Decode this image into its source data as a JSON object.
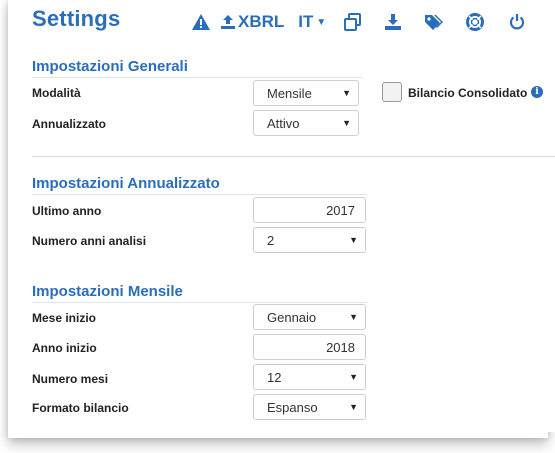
{
  "header": {
    "title": "Settings",
    "icons": [
      "warning-icon",
      "upload-icon",
      "copy-icon",
      "download-icon",
      "tags-icon",
      "lifebuoy-icon",
      "power-icon"
    ],
    "xbrl_label": "XBRL",
    "language": "IT"
  },
  "sections": {
    "generali": {
      "title": "Impostazioni Generali",
      "modalita_label": "Modalità",
      "modalita_value": "Mensile",
      "annualizzato_label": "Annualizzato",
      "annualizzato_value": "Attivo",
      "consolidato_label": "Bilancio Consolidato",
      "consolidato_checked": false
    },
    "annualizzato": {
      "title": "Impostazioni Annualizzato",
      "ultimo_anno_label": "Ultimo anno",
      "ultimo_anno_value": "2017",
      "numero_anni_label": "Numero anni analisi",
      "numero_anni_value": "2"
    },
    "mensile": {
      "title": "Impostazioni Mensile",
      "mese_inizio_label": "Mese inizio",
      "mese_inizio_value": "Gennaio",
      "anno_inizio_label": "Anno inizio",
      "anno_inizio_value": "2018",
      "numero_mesi_label": "Numero mesi",
      "numero_mesi_value": "12",
      "formato_label": "Formato bilancio",
      "formato_value": "Espanso"
    }
  },
  "colors": {
    "accent": "#2a6ebb"
  }
}
